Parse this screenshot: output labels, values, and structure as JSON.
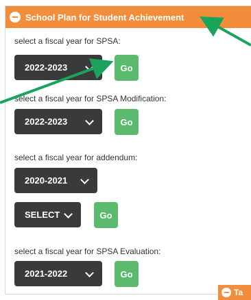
{
  "panel": {
    "title": "School Plan for Student Achievement",
    "sections": [
      {
        "label": "select a fiscal year for SPSA:",
        "select_value": "2022-2023",
        "go": "Go"
      },
      {
        "label": "select a fiscal year for SPSA Modification:",
        "select_value": "2022-2023",
        "go": "Go"
      },
      {
        "label": "select a fiscal year for addendum:",
        "select_value": "2020-2021",
        "select2_value": "SELECT",
        "go": "Go"
      },
      {
        "label": "select a fiscal year for SPSA Evaluation:",
        "select_value": "2021-2022",
        "go": "Go"
      }
    ]
  },
  "next_tab": {
    "title": "Ta"
  },
  "colors": {
    "header": "#f28d3c",
    "go_button": "#5cba6f",
    "select_bg": "#3a3a3a",
    "annotation_arrow": "#1aa35a"
  }
}
